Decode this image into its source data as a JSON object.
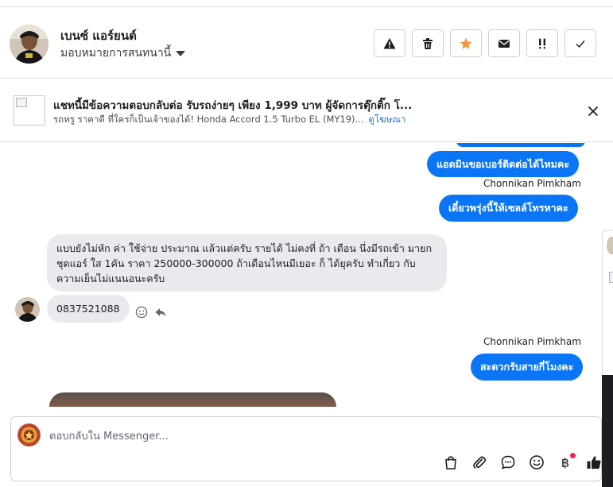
{
  "header": {
    "contact_name": "เบนซ์ แอร์ยนต์",
    "assign_label": "มอบหมายการสนทนานี้",
    "actions": [
      "alert-icon",
      "trash-icon",
      "star-icon",
      "mail-icon",
      "double-exclaim-icon",
      "check-icon"
    ],
    "star_color": "#f7923b"
  },
  "ad": {
    "title": "แชทนี้มีข้อความตอบกลับต่อ รับรถง่ายๆ เพียง 1,999 บาท ผู้จัดการตุ๊กติ๊ก โ...",
    "subtitle": "รถหรู ราคาดี ที่ใครก็เป็นเจ้าของได้! Honda Accord 1.5 Turbo EL (MY19)...",
    "link": "ดูโฆษณา"
  },
  "messages": {
    "out1": "แอดมินขอเบอร์ติดต่อได้ไหมคะ",
    "sender1": "Chonnikan Pimkham",
    "out2": "เดี๋ยวพรุ่งนี้ให้เซลล์โทรหาคะ",
    "in1": "แบบยังไม่หัก ค่า ใช้จ่าย  ประมาณ แล้วแต่ครับ รายได้ ไม่คงที่ ถ้า เดือน นึ่งมีรถเข้า มายกชุดแอร์ ใส 1คัน ราคา 250000-300000 ถ้าเดือนไหนมีเยอะ ก็ ได้ยุครับ ทำเกี่ยว กับความเย็นไม่แนนอนะครับ",
    "in2": "0837521088",
    "sender2": "Chonnikan Pimkham",
    "out3": "สะดวกรับสายกี่โมงคะ"
  },
  "composer": {
    "placeholder": "ตอบกลับใน Messenger...",
    "baht_symbol": "฿",
    "tools": [
      "bag-icon",
      "paperclip-icon",
      "chat-bubble-icon",
      "smiley-icon",
      "baht-icon",
      "thumbs-up-icon"
    ]
  },
  "colors": {
    "brand_blue": "#0b76f5",
    "link_blue": "#216fdb",
    "incoming_bubble": "#e9eaed",
    "notification_red": "#f02849"
  }
}
